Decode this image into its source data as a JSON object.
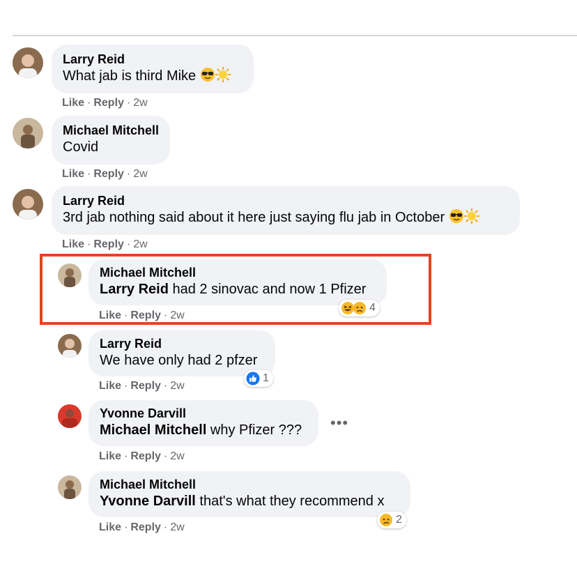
{
  "thread": {
    "comments": [
      {
        "author": "Larry Reid",
        "text": "What jab is third Mike",
        "emojis": [
          "sunglasses-emoji",
          "sun-emoji"
        ],
        "like": "Like",
        "reply": "Reply",
        "time": "2w"
      },
      {
        "author": "Michael Mitchell",
        "text": "Covid",
        "like": "Like",
        "reply": "Reply",
        "time": "2w"
      },
      {
        "author": "Larry Reid",
        "text": "3rd jab nothing said about it here just saying flu jab in October",
        "emojis": [
          "sunglasses-emoji",
          "sun-emoji"
        ],
        "like": "Like",
        "reply": "Reply",
        "time": "2w"
      }
    ],
    "replies": [
      {
        "author": "Michael Mitchell",
        "mention": "Larry Reid",
        "text": " had 2 sinovac and now 1 Pfizer",
        "like": "Like",
        "reply": "Reply",
        "time": "2w",
        "reactions": {
          "icons": [
            "haha-reaction-icon",
            "sad-reaction-icon"
          ],
          "count": "4"
        },
        "highlighted": true
      },
      {
        "author": "Larry Reid",
        "text": "We have only had 2 pfzer",
        "like": "Like",
        "reply": "Reply",
        "time": "2w",
        "reactions": {
          "icons": [
            "like-reaction-icon"
          ],
          "count": "1"
        }
      },
      {
        "author": "Yvonne Darvill",
        "mention": "Michael Mitchell",
        "text": " why Pfizer ???",
        "like": "Like",
        "reply": "Reply",
        "time": "2w",
        "more_menu": "•••"
      },
      {
        "author": "Michael Mitchell",
        "mention": "Yvonne Darvill",
        "text": " that's what they recommend x",
        "like": "Like",
        "reply": "Reply",
        "time": "2w",
        "reactions": {
          "icons": [
            "sad-reaction-icon"
          ],
          "count": "2"
        }
      }
    ],
    "separator": "·",
    "colors": {
      "highlight_border": "#e2451f",
      "bubble_bg": "#f0f2f5",
      "meta_text": "#65676b",
      "like_blue": "#1877f2",
      "reaction_yellow": "#f7b928"
    }
  }
}
